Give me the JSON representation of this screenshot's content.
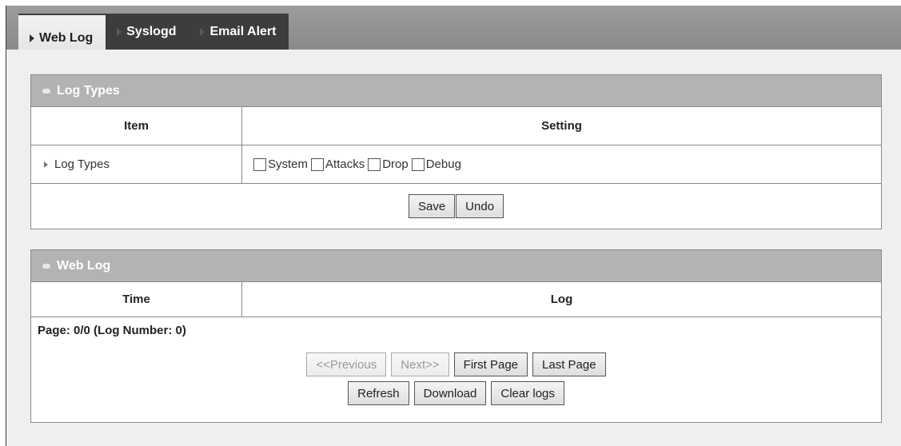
{
  "tabs": [
    {
      "label": "Web Log",
      "active": true
    },
    {
      "label": "Syslogd",
      "active": false
    },
    {
      "label": "Email Alert",
      "active": false
    }
  ],
  "log_types_panel": {
    "title": "Log Types",
    "col_item": "Item",
    "col_setting": "Setting",
    "row_label": "Log Types",
    "options": [
      "System",
      "Attacks",
      "Drop",
      "Debug"
    ],
    "save_label": "Save",
    "undo_label": "Undo"
  },
  "web_log_panel": {
    "title": "Web Log",
    "col_time": "Time",
    "col_log": "Log",
    "page_info": "Page: 0/0 (Log Number: 0)",
    "previous_label": "<<Previous",
    "next_label": "Next>>",
    "first_page_label": "First Page",
    "last_page_label": "Last Page",
    "refresh_label": "Refresh",
    "download_label": "Download",
    "clear_logs_label": "Clear logs"
  }
}
